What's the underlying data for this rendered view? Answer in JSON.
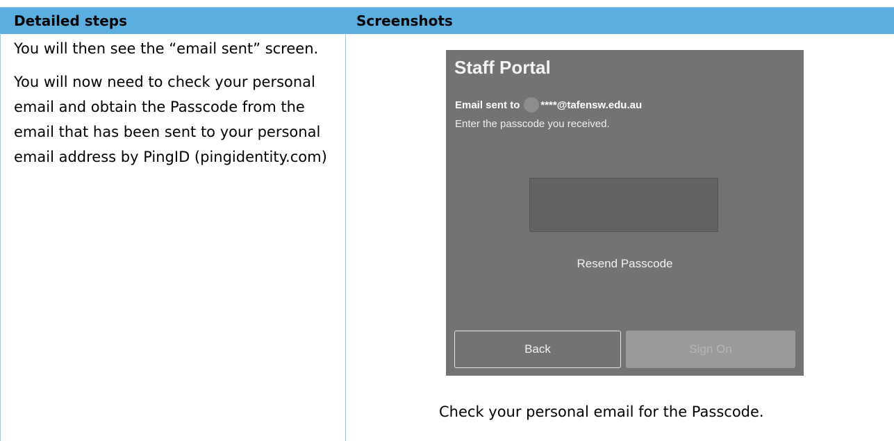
{
  "table": {
    "headers": [
      "Detailed steps",
      "Screenshots"
    ],
    "header_color": "#5aafe0"
  },
  "steps": {
    "paragraphs": [
      "You will then see the “email sent” screen.",
      "You will now need to check your personal email and obtain the Passcode from the email that has been sent to your personal email address by PingID (pingidentity.com)"
    ]
  },
  "portal": {
    "title": "Staff Portal",
    "sent_prefix": "Email sent to",
    "sent_email": "****@tafensw.edu.au",
    "instruction": "Enter the passcode you received.",
    "passcode_value": "",
    "resend_label": "Resend Passcode",
    "back_label": "Back",
    "signon_label": "Sign On",
    "background_color": "#737373"
  },
  "caption": "Check your personal email for the Passcode."
}
